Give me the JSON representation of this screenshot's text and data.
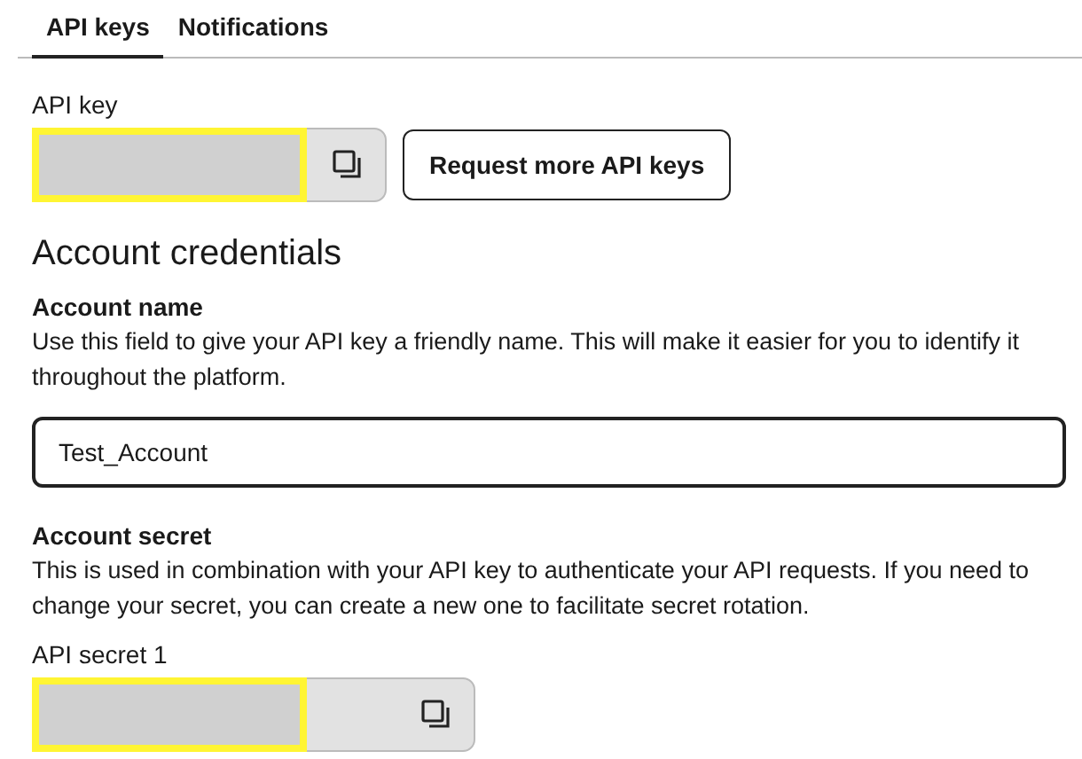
{
  "tabs": [
    {
      "label": "API keys",
      "selected": true
    },
    {
      "label": "Notifications",
      "selected": false
    }
  ],
  "api_key": {
    "label": "API key",
    "redacted": true,
    "request_button": "Request more API keys"
  },
  "section_title": "Account credentials",
  "account_name": {
    "label": "Account name",
    "description": "Use this field to give your API key a friendly name. This will make it easier for you to identify it throughout the platform.",
    "value": "Test_Account"
  },
  "account_secret": {
    "label": "Account secret",
    "description": "This is used in combination with your API key to authenticate your API requests. If you need to change your secret, you can create a new one to facilitate secret rotation.",
    "secret_label": "API secret 1",
    "redacted": true
  }
}
